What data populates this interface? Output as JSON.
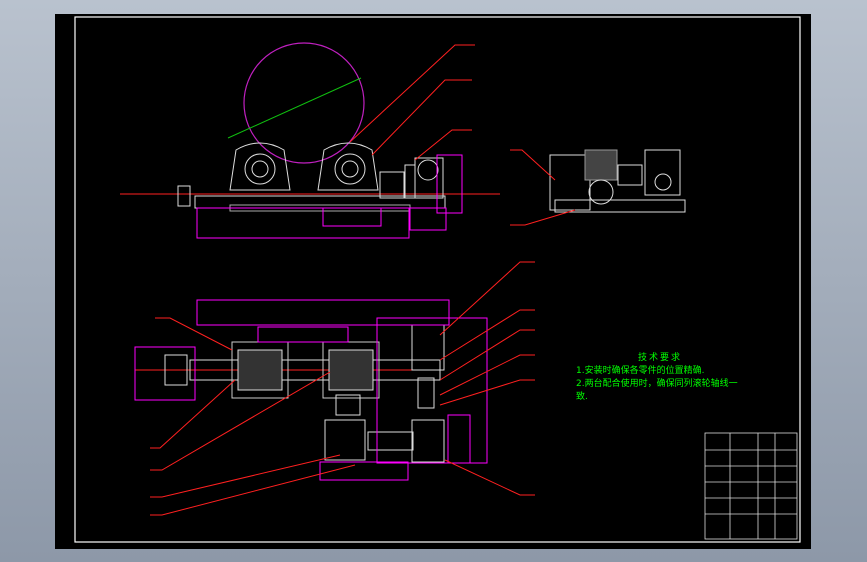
{
  "notes": {
    "title": "技术要求",
    "line1": "1.安装时确保各零件的位置精确.",
    "line2": "2.两台配合使用时，确保同列滚轮轴线一",
    "line3": "致."
  },
  "colors": {
    "background": "#000000",
    "frame": "#ffffff",
    "leader": "#ff0000",
    "text": "#00ff00",
    "workpiece": "#ff00ff",
    "dimension": "#ff00ff",
    "drawing": "#ffffff"
  }
}
